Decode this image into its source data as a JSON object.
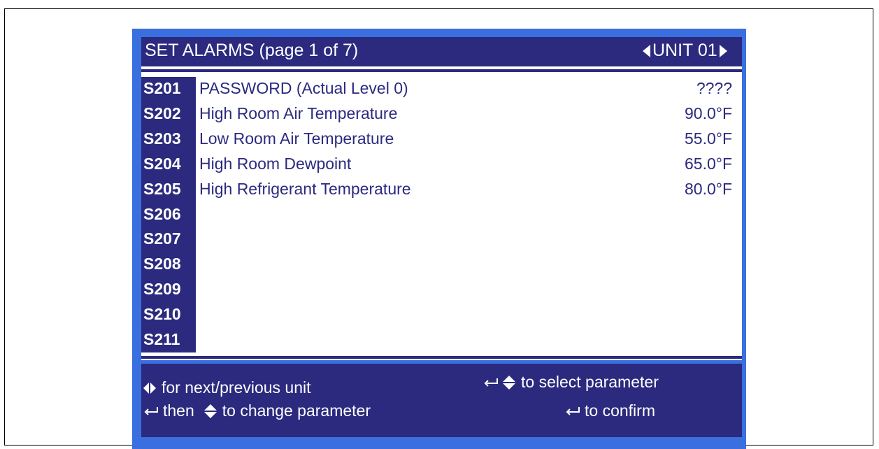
{
  "header": {
    "title": "SET ALARMS (page 1 of 7)",
    "unit": "UNIT 01"
  },
  "rows": [
    {
      "code": "S201",
      "label": "PASSWORD   (Actual Level  0)",
      "value": "????"
    },
    {
      "code": "S202",
      "label": "High Room Air Temperature",
      "value": "90.0°F"
    },
    {
      "code": "S203",
      "label": "Low Room Air Temperature",
      "value": "55.0°F"
    },
    {
      "code": "S204",
      "label": "High Room Dewpoint",
      "value": "65.0°F"
    },
    {
      "code": "S205",
      "label": "High Refrigerant Temperature",
      "value": "80.0°F"
    },
    {
      "code": "S206",
      "label": "",
      "value": ""
    },
    {
      "code": "S207",
      "label": "",
      "value": ""
    },
    {
      "code": "S208",
      "label": "",
      "value": ""
    },
    {
      "code": "S209",
      "label": "",
      "value": ""
    },
    {
      "code": "S210",
      "label": "",
      "value": ""
    },
    {
      "code": "S211",
      "label": "",
      "value": ""
    }
  ],
  "footer": {
    "next_prev": "for next/previous unit",
    "select_param": "to select parameter",
    "then": "then",
    "change_param": "to change parameter",
    "confirm": "to confirm"
  },
  "icons": {
    "left_right": "left-right-arrows-icon",
    "up_down": "up-down-arrows-icon",
    "enter": "enter-key-icon"
  },
  "colors": {
    "screen_bg": "#3a6fe0",
    "panel_dark": "#2b2a7f",
    "content_bg": "#ffffff",
    "text_dark": "#2b2a7f"
  }
}
